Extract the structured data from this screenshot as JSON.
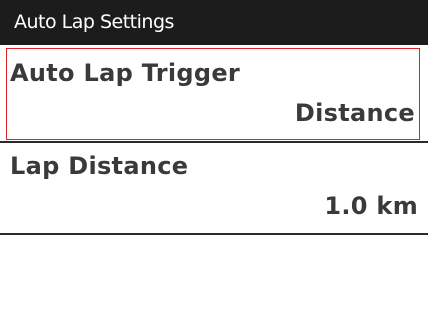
{
  "header": {
    "title": "Auto Lap Settings"
  },
  "settings": [
    {
      "label": "Auto Lap Trigger",
      "value": "Distance",
      "selected": true
    },
    {
      "label": "Lap Distance",
      "value": "1.0 km",
      "selected": false
    }
  ],
  "colors": {
    "titlebar_bg": "#1c1c1c",
    "selection_border": "#d9242a",
    "text": "#3a3a3a",
    "background": "#ffffff"
  }
}
